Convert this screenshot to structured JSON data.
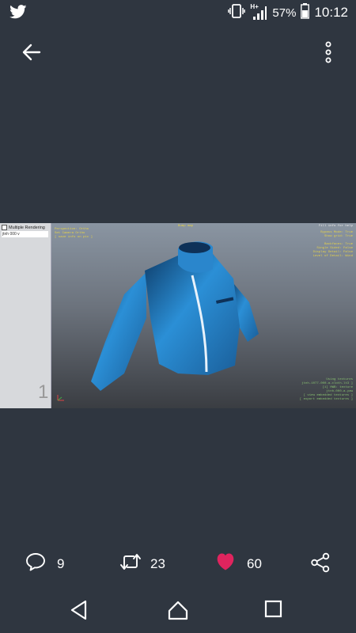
{
  "status_bar": {
    "app_icon": "twitter-icon",
    "icons": [
      "vibrate-icon",
      "signal-icon",
      "battery-icon"
    ],
    "network_type": "H+",
    "battery": "57%",
    "time": "10:12"
  },
  "app_bar": {
    "back_icon": "arrow-left-icon",
    "more_icon": "more-vertical-icon"
  },
  "media": {
    "side_panel": {
      "checkbox_label": "Multiple Rendering",
      "item_label": "jtnh 000 v",
      "page_number": "1"
    },
    "viewport": {
      "top_center": "Bump map",
      "top_left": "Perspective: Ortho\nSet Camera Ortho\n[ save info on pic ]",
      "top_right": "Fill info for help",
      "right_info": "Bypass Mode: True\nShow grid: True\n\nBackfaces: True\nSingle Sided: False\nDisplay Detail: False\nLevel of Detail: Wind",
      "bottom_right": "Using textures\njtnh-1077-000-a-cloth-lt3 ]\n[i] HWB: texture\njtnh-000-a-yaw\n[ view embedded textures ]\n[ export embedded textures ]"
    }
  },
  "actions": {
    "reply": {
      "icon": "reply-icon",
      "count": "9"
    },
    "retweet": {
      "icon": "retweet-icon",
      "count": "23"
    },
    "like": {
      "icon": "heart-icon",
      "count": "60"
    },
    "share": {
      "icon": "share-icon"
    }
  },
  "colors": {
    "background": "#2f3640",
    "like": "#e0245e",
    "jacket": "#2b8fd6"
  }
}
